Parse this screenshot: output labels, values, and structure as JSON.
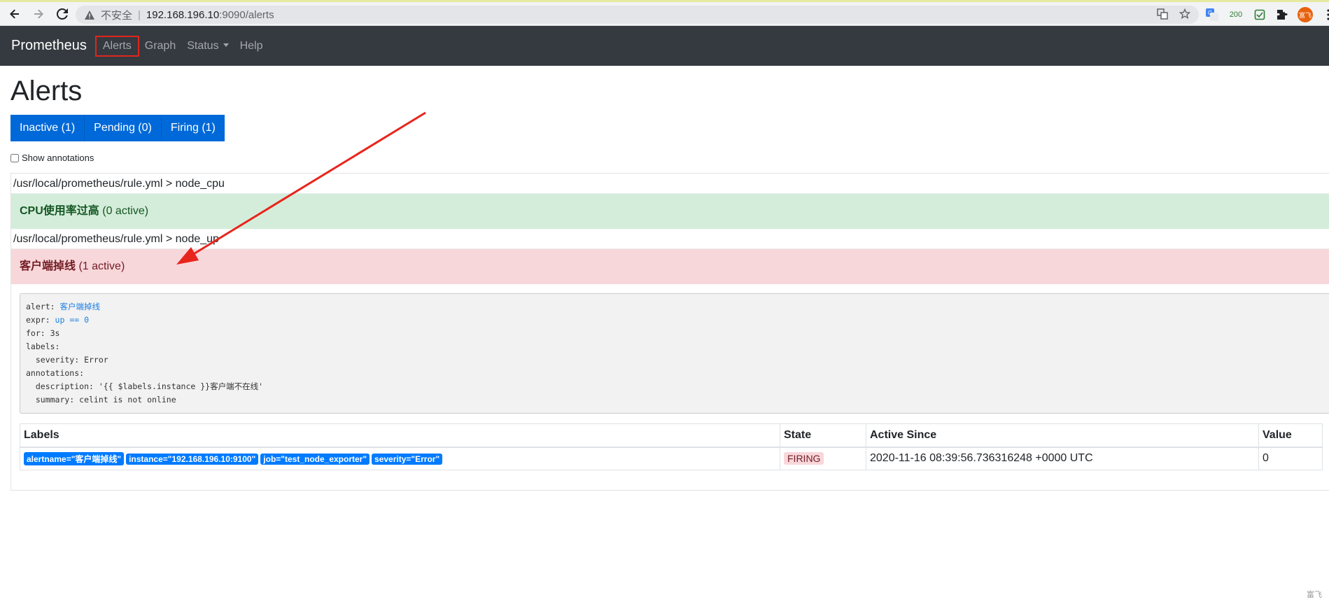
{
  "browser": {
    "insecure_label": "不安全",
    "url_host": "192.168.196.10",
    "url_rest": ":9090/alerts",
    "ext_badge": "200",
    "avatar_text": "富飞"
  },
  "nav": {
    "brand": "Prometheus",
    "alerts": "Alerts",
    "graph": "Graph",
    "status": "Status",
    "help": "Help"
  },
  "page": {
    "title": "Alerts",
    "filters": [
      "Inactive (1)",
      "Pending (0)",
      "Firing (1)"
    ],
    "show_annotations": "Show annotations"
  },
  "groups": [
    {
      "header": "/usr/local/prometheus/rule.yml > node_cpu",
      "rule_name": "CPU使用率过高",
      "rule_count": "(0 active)"
    },
    {
      "header": "/usr/local/prometheus/rule.yml > node_up",
      "rule_name": "客户端掉线",
      "rule_count": "(1 active)"
    }
  ],
  "rule_def": {
    "alert_key": "alert: ",
    "alert_val": "客户端掉线",
    "expr_key": "expr: ",
    "expr_val": "up == 0",
    "for": "for: 3s",
    "labels": "labels:",
    "severity": "  severity: Error",
    "annotations": "annotations:",
    "description": "  description: '{{ $labels.instance }}客户端不在线'",
    "summary": "  summary: celint is not online"
  },
  "table": {
    "headers": [
      "Labels",
      "State",
      "Active Since",
      "Value"
    ],
    "row": {
      "labels": [
        "alertname=\"客户端掉线\"",
        "instance=\"192.168.196.10:9100\"",
        "job=\"test_node_exporter\"",
        "severity=\"Error\""
      ],
      "state": "FIRING",
      "active_since": "2020-11-16 08:39:56.736316248 +0000 UTC",
      "value": "0"
    }
  },
  "watermark": "富飞"
}
